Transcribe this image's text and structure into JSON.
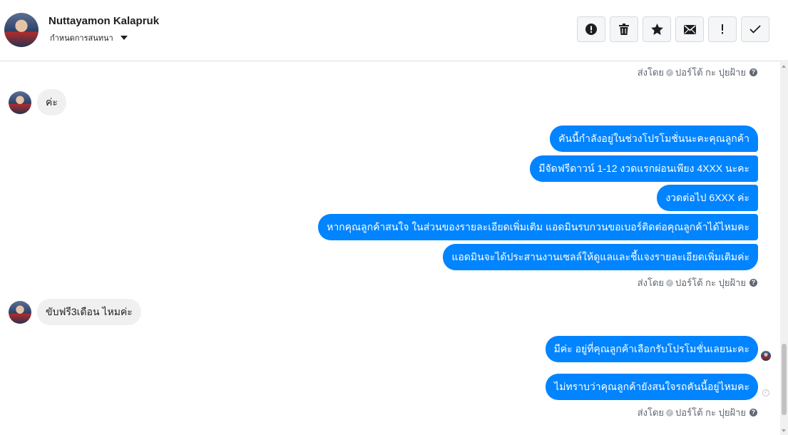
{
  "header": {
    "contact_name": "Nuttayamon Kalapruk",
    "assign_label": "กำหนดการสนทนา",
    "actions": [
      {
        "icon": "alert-circle-icon",
        "name": "mark-spam-button"
      },
      {
        "icon": "trash-icon",
        "name": "delete-button"
      },
      {
        "icon": "star-icon",
        "name": "star-button"
      },
      {
        "icon": "envelope-icon",
        "name": "mark-unread-button"
      },
      {
        "icon": "exclamation-icon",
        "name": "follow-up-button"
      },
      {
        "icon": "check-icon",
        "name": "mark-done-button"
      }
    ]
  },
  "sent_by": {
    "prefix": "ส่งโดย",
    "agent": "ปอร์โต้ กะ ปุยฝ้าย"
  },
  "messages": {
    "in1": "ค่ะ",
    "out1": "คันนี้กำลังอยู่ในช่วงโปรโมชั่นนะคะคุณลูกค้า",
    "out2": "มีจัดฟรีดาวน์ 1-12 งวดแรกผ่อนเพียง 4XXX นะคะ",
    "out3": "งวดต่อไป 6XXX ค่ะ",
    "out4": "หากคุณลูกค้าสนใจ ในส่วนของรายละเอียดเพิ่มเติม แอดมินรบกวนขอเบอร์ติดต่อคุณลูกค้าได้ไหมคะ",
    "out5": "แอดมินจะได้ประสานงานเซลล์ให้ดูแลและชี้แจงรายละเอียดเพิ่มเติมค่ะ",
    "in2": "ขับฟรี3เดือน ไหมค่ะ",
    "out6": "มีค่ะ อยู่ที่คุณลูกค้าเลือกรับโปรโมชั่นเลยนะคะ",
    "out7": "ไม่ทราบว่าคุณลูกค้ายังสนใจรถคันนี้อยู่ไหมคะ"
  },
  "colors": {
    "outgoing_bubble": "#0084ff",
    "incoming_bubble": "#f0f0f0"
  }
}
